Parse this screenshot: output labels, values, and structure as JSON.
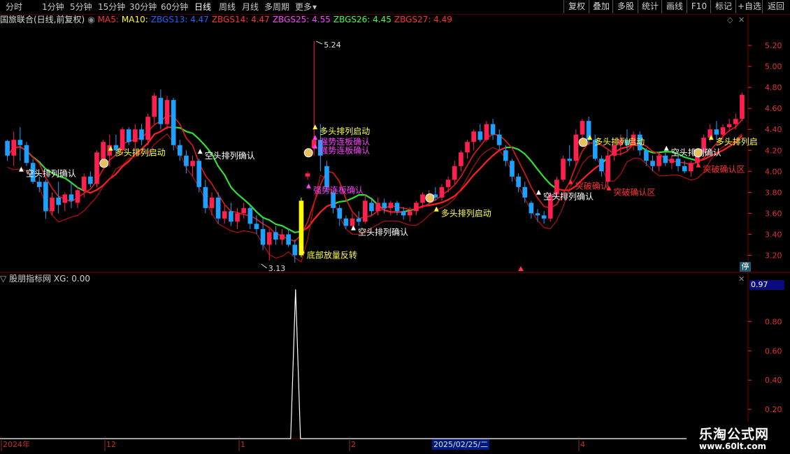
{
  "toolbar": {
    "timeframes": [
      "分时",
      "1分钟",
      "5分钟",
      "15分钟",
      "30分钟",
      "60分钟",
      "日线",
      "周线",
      "月线",
      "多周期",
      "更多"
    ],
    "active": "日线",
    "right_buttons": [
      "复权",
      "叠加",
      "多股",
      "统计",
      "画线",
      "F10",
      "标记",
      "+自选",
      "返回"
    ]
  },
  "legend": {
    "stock": "国旅联合(日线,前复权)",
    "items": [
      {
        "label": "MA5:",
        "color": "#ff3030"
      },
      {
        "label": "MA10:",
        "color": "#ffff00"
      },
      {
        "label": "ZBGS13: 4.47",
        "color": "#2060ff"
      },
      {
        "label": "ZBGS14: 4.47",
        "color": "#ff3030"
      },
      {
        "label": "ZBGS25: 4.55",
        "color": "#ff40ff"
      },
      {
        "label": "ZBGS26: 4.45",
        "color": "#40ff40"
      },
      {
        "label": "ZBGS27: 4.49",
        "color": "#ff3030"
      }
    ]
  },
  "indicator": {
    "title": "股朋指标网",
    "value_label": "XG: 0.00",
    "current_value": "0.97"
  },
  "stop_badge": "停",
  "date_axis": {
    "labels": [
      "2024年",
      "12",
      "1",
      "2",
      "2025/02/25/二",
      "4"
    ]
  },
  "watermark": {
    "line1": "乐淘公式网",
    "line2": "www.60lt.com"
  },
  "colors": {
    "up": "#ff2050",
    "down": "#1ea0ff",
    "bg": "#000000",
    "grid": "#800000",
    "axis_text": "#e03030"
  },
  "chart_data": {
    "type": "candlestick",
    "price_axis": {
      "ticks": [
        3.2,
        3.4,
        3.6,
        3.8,
        4.0,
        4.2,
        4.4,
        4.6,
        4.8,
        5.0,
        5.2
      ],
      "ylim": [
        3.05,
        5.38
      ]
    },
    "indicator_axis": {
      "ticks": [
        0.2,
        0.4,
        0.6,
        0.8
      ],
      "ylim": [
        0,
        1.05
      ]
    },
    "high_label": "5.24",
    "low_label": "3.13",
    "candles": [
      [
        4.29,
        4.3,
        4.1,
        4.15
      ],
      [
        4.15,
        4.38,
        4.05,
        4.3
      ],
      [
        4.3,
        4.42,
        4.1,
        4.25
      ],
      [
        4.25,
        4.28,
        4.05,
        4.08
      ],
      [
        4.08,
        4.12,
        3.88,
        3.9
      ],
      [
        3.9,
        3.95,
        3.8,
        3.85
      ],
      [
        3.9,
        3.92,
        3.55,
        3.62
      ],
      [
        3.62,
        3.8,
        3.58,
        3.75
      ],
      [
        3.75,
        3.9,
        3.6,
        3.68
      ],
      [
        3.7,
        3.8,
        3.62,
        3.78
      ],
      [
        3.78,
        3.9,
        3.65,
        3.72
      ],
      [
        3.7,
        3.85,
        3.65,
        3.82
      ],
      [
        3.82,
        3.98,
        3.75,
        3.95
      ],
      [
        3.95,
        4.0,
        3.85,
        3.88
      ],
      [
        3.88,
        4.2,
        3.85,
        4.18
      ],
      [
        4.1,
        4.3,
        4.05,
        4.28
      ],
      [
        4.15,
        4.35,
        4.05,
        4.25
      ],
      [
        4.25,
        4.35,
        4.15,
        4.2
      ],
      [
        4.2,
        4.42,
        4.15,
        4.4
      ],
      [
        4.4,
        4.42,
        4.25,
        4.28
      ],
      [
        4.28,
        4.45,
        4.2,
        4.4
      ],
      [
        4.4,
        4.45,
        4.25,
        4.3
      ],
      [
        4.3,
        4.55,
        4.25,
        4.52
      ],
      [
        4.52,
        4.75,
        4.45,
        4.72
      ],
      [
        4.7,
        4.78,
        4.4,
        4.45
      ],
      [
        4.45,
        4.72,
        4.4,
        4.68
      ],
      [
        4.68,
        4.7,
        4.2,
        4.25
      ],
      [
        4.25,
        4.3,
        4.1,
        4.15
      ],
      [
        4.15,
        4.2,
        3.98,
        4.05
      ],
      [
        4.05,
        4.15,
        3.95,
        4.1
      ],
      [
        4.1,
        4.12,
        3.8,
        3.85
      ],
      [
        3.85,
        3.92,
        3.6,
        3.65
      ],
      [
        3.65,
        3.8,
        3.58,
        3.75
      ],
      [
        3.75,
        3.8,
        3.5,
        3.55
      ],
      [
        3.55,
        3.68,
        3.5,
        3.62
      ],
      [
        3.62,
        3.7,
        3.48,
        3.52
      ],
      [
        3.52,
        3.65,
        3.45,
        3.6
      ],
      [
        3.6,
        3.7,
        3.55,
        3.65
      ],
      [
        3.65,
        3.68,
        3.45,
        3.5
      ],
      [
        3.5,
        3.58,
        3.4,
        3.45
      ],
      [
        3.45,
        3.55,
        3.25,
        3.3
      ],
      [
        3.3,
        3.45,
        3.15,
        3.42
      ],
      [
        3.42,
        3.48,
        3.3,
        3.35
      ],
      [
        3.35,
        3.45,
        3.3,
        3.4
      ],
      [
        3.4,
        3.45,
        3.28,
        3.3
      ],
      [
        3.3,
        3.35,
        3.13,
        3.2
      ],
      [
        3.2,
        3.75,
        3.18,
        3.72
      ],
      [
        3.95,
        4.0,
        3.92,
        3.98
      ],
      [
        4.22,
        5.24,
        4.15,
        4.3
      ],
      [
        4.3,
        4.45,
        4.0,
        4.15
      ],
      [
        4.05,
        4.1,
        3.8,
        3.85
      ],
      [
        3.8,
        3.82,
        3.6,
        3.65
      ],
      [
        3.65,
        3.68,
        3.48,
        3.55
      ],
      [
        3.55,
        3.58,
        3.45,
        3.48
      ],
      [
        3.48,
        3.6,
        3.45,
        3.55
      ],
      [
        3.55,
        3.62,
        3.48,
        3.52
      ],
      [
        3.52,
        3.78,
        3.5,
        3.72
      ],
      [
        3.7,
        3.75,
        3.58,
        3.62
      ],
      [
        3.62,
        3.75,
        3.58,
        3.7
      ],
      [
        3.7,
        3.74,
        3.6,
        3.65
      ],
      [
        3.65,
        3.72,
        3.58,
        3.7
      ],
      [
        3.7,
        3.72,
        3.58,
        3.62
      ],
      [
        3.62,
        3.66,
        3.54,
        3.58
      ],
      [
        3.58,
        3.66,
        3.52,
        3.62
      ],
      [
        3.62,
        3.72,
        3.58,
        3.7
      ],
      [
        3.7,
        3.8,
        3.65,
        3.78
      ],
      [
        3.74,
        3.82,
        3.7,
        3.78
      ],
      [
        3.78,
        3.85,
        3.72,
        3.75
      ],
      [
        3.75,
        3.88,
        3.72,
        3.85
      ],
      [
        3.85,
        3.95,
        3.8,
        3.92
      ],
      [
        3.92,
        4.1,
        3.88,
        4.05
      ],
      [
        4.05,
        4.2,
        4.0,
        4.18
      ],
      [
        4.18,
        4.3,
        4.12,
        4.28
      ],
      [
        4.28,
        4.4,
        4.2,
        4.38
      ],
      [
        4.38,
        4.45,
        4.28,
        4.3
      ],
      [
        4.3,
        4.48,
        4.28,
        4.45
      ],
      [
        4.45,
        4.5,
        4.3,
        4.35
      ],
      [
        4.35,
        4.4,
        4.2,
        4.25
      ],
      [
        4.2,
        4.25,
        4.05,
        4.1
      ],
      [
        4.1,
        4.12,
        3.9,
        3.95
      ],
      [
        3.95,
        3.98,
        3.8,
        3.85
      ],
      [
        3.85,
        3.9,
        3.7,
        3.75
      ],
      [
        3.7,
        3.72,
        3.55,
        3.6
      ],
      [
        3.6,
        3.64,
        3.52,
        3.58
      ],
      [
        3.58,
        3.62,
        3.5,
        3.55
      ],
      [
        3.55,
        3.8,
        3.52,
        3.78
      ],
      [
        3.78,
        3.95,
        3.75,
        3.92
      ],
      [
        3.92,
        4.15,
        3.9,
        4.12
      ],
      [
        4.12,
        4.25,
        4.05,
        4.1
      ],
      [
        4.1,
        4.4,
        4.05,
        4.35
      ],
      [
        4.35,
        4.5,
        4.3,
        4.48
      ],
      [
        4.48,
        4.52,
        4.25,
        4.3
      ],
      [
        4.3,
        4.35,
        4.1,
        4.12
      ],
      [
        4.12,
        4.15,
        3.95,
        4.0
      ],
      [
        3.9,
        4.2,
        3.85,
        4.15
      ],
      [
        4.15,
        4.3,
        4.1,
        4.25
      ],
      [
        4.25,
        4.35,
        4.15,
        4.3
      ],
      [
        4.3,
        4.4,
        4.2,
        4.25
      ],
      [
        4.25,
        4.38,
        4.2,
        4.35
      ],
      [
        4.35,
        4.38,
        4.15,
        4.2
      ],
      [
        4.2,
        4.22,
        4.05,
        4.1
      ],
      [
        4.1,
        4.15,
        4.0,
        4.05
      ],
      [
        4.05,
        4.18,
        4.0,
        4.15
      ],
      [
        4.15,
        4.18,
        4.05,
        4.08
      ],
      [
        4.08,
        4.15,
        4.02,
        4.12
      ],
      [
        4.12,
        4.15,
        4.0,
        4.05
      ],
      [
        4.05,
        4.1,
        3.98,
        4.0
      ],
      [
        4.0,
        4.1,
        3.95,
        4.08
      ],
      [
        4.08,
        4.2,
        4.05,
        4.18
      ],
      [
        4.18,
        4.35,
        4.15,
        4.32
      ],
      [
        4.32,
        4.45,
        4.28,
        4.4
      ],
      [
        4.4,
        4.48,
        4.3,
        4.35
      ],
      [
        4.35,
        4.45,
        4.3,
        4.42
      ],
      [
        4.42,
        4.5,
        4.38,
        4.45
      ],
      [
        4.45,
        4.55,
        4.4,
        4.5
      ],
      [
        4.5,
        4.75,
        4.48,
        4.73
      ]
    ],
    "signal_index": 47,
    "annotations": [
      {
        "i": 2,
        "price": 3.98,
        "text": "空头排列确认",
        "color": "#ffffff"
      },
      {
        "i": 16,
        "price": 4.18,
        "text": "多头排列启动",
        "color": "#ffff40"
      },
      {
        "i": 30,
        "price": 4.15,
        "text": "空头排列确认",
        "color": "#ffffff"
      },
      {
        "i": 48,
        "price": 4.38,
        "text": "多头排列启动",
        "color": "#ffff40"
      },
      {
        "i": 48,
        "price": 4.28,
        "text": "强势连板确认",
        "color": "#ff40ff"
      },
      {
        "i": 48,
        "price": 4.2,
        "text": "强势连板确认",
        "color": "#ff40ff"
      },
      {
        "i": 47,
        "price": 3.82,
        "text": "强势连板确认",
        "color": "#ff40ff"
      },
      {
        "i": 46,
        "price": 3.2,
        "text": "底部放量反转",
        "color": "#ffff40"
      },
      {
        "i": 54,
        "price": 3.42,
        "text": "空头排列确认",
        "color": "#ffffff"
      },
      {
        "i": 67,
        "price": 3.6,
        "text": "多头排列启动",
        "color": "#ffff40"
      },
      {
        "i": 83,
        "price": 3.76,
        "text": "空头排列确认",
        "color": "#ffffff"
      },
      {
        "i": 88,
        "price": 3.86,
        "text": "突破确认",
        "color": "#ff3030"
      },
      {
        "i": 94,
        "price": 3.8,
        "text": "突破确认区",
        "color": "#ff3030"
      },
      {
        "i": 91,
        "price": 4.28,
        "text": "多头排列启动",
        "color": "#ffff40"
      },
      {
        "i": 103,
        "price": 4.18,
        "text": "空头排列确认",
        "color": "#ffffff"
      },
      {
        "i": 108,
        "price": 4.02,
        "text": "突破确认区",
        "color": "#ff3030"
      },
      {
        "i": 110,
        "price": 4.28,
        "text": "多头排列启",
        "color": "#ffff40"
      }
    ]
  }
}
